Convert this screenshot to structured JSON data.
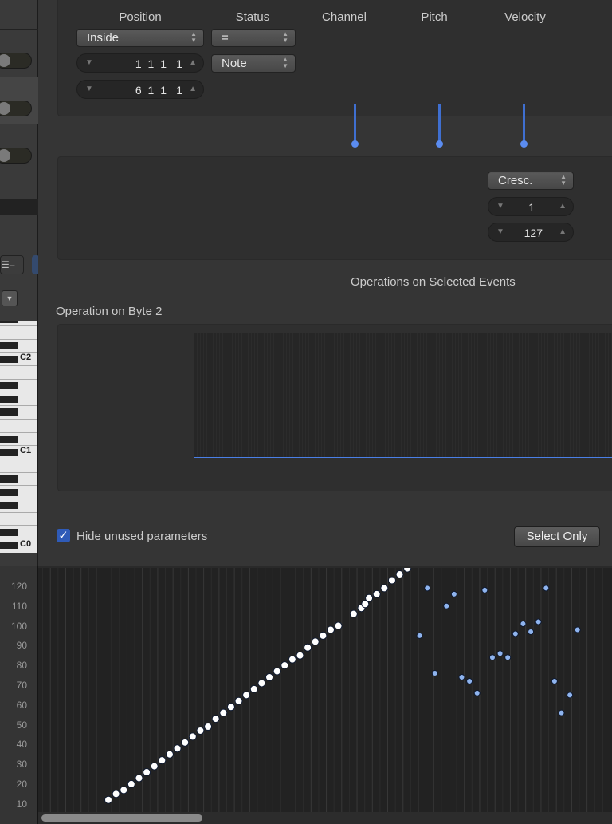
{
  "transform": {
    "columns": {
      "position": "Position",
      "status": "Status",
      "channel": "Channel",
      "pitch": "Pitch",
      "velocity": "Velocity"
    },
    "position_condition": "Inside",
    "position_from": "1 1 1",
    "position_from_tick": "1",
    "position_to": "6 1 1",
    "position_to_tick": "1",
    "status_condition": "=",
    "status_value": "Note",
    "velocity_operation": "Cresc.",
    "velocity_value1": "1",
    "velocity_value2": "127",
    "operations_title": "Operations on Selected Events",
    "byte2_title": "Operation on Byte 2",
    "hide_unused_label": "Hide unused parameters",
    "hide_unused_checked": true,
    "select_only_label": "Select Only",
    "accent_color": "#4a7fe6"
  },
  "piano": {
    "labels": [
      "C2",
      "C1",
      "C0"
    ]
  },
  "velocity_lane": {
    "y_ticks": [
      "120",
      "110",
      "100",
      "90",
      "80",
      "70",
      "60",
      "50",
      "40",
      "30",
      "20",
      "10"
    ],
    "selected_color": "#ffffff",
    "unselected_color": "#8fb4ee",
    "selected_events": [
      {
        "step": 0,
        "velocity": 8
      },
      {
        "step": 1,
        "velocity": 11
      },
      {
        "step": 2,
        "velocity": 13
      },
      {
        "step": 3,
        "velocity": 16
      },
      {
        "step": 4,
        "velocity": 19
      },
      {
        "step": 5,
        "velocity": 22
      },
      {
        "step": 6,
        "velocity": 25
      },
      {
        "step": 7,
        "velocity": 28
      },
      {
        "step": 8,
        "velocity": 31
      },
      {
        "step": 9,
        "velocity": 34
      },
      {
        "step": 10,
        "velocity": 37
      },
      {
        "step": 11,
        "velocity": 40
      },
      {
        "step": 12,
        "velocity": 43
      },
      {
        "step": 13,
        "velocity": 45
      },
      {
        "step": 14,
        "velocity": 49
      },
      {
        "step": 15,
        "velocity": 52
      },
      {
        "step": 16,
        "velocity": 55
      },
      {
        "step": 17,
        "velocity": 58
      },
      {
        "step": 18,
        "velocity": 61
      },
      {
        "step": 19,
        "velocity": 64
      },
      {
        "step": 20,
        "velocity": 67
      },
      {
        "step": 21,
        "velocity": 70
      },
      {
        "step": 22,
        "velocity": 73
      },
      {
        "step": 23,
        "velocity": 76
      },
      {
        "step": 24,
        "velocity": 79
      },
      {
        "step": 25,
        "velocity": 81
      },
      {
        "step": 26,
        "velocity": 85
      },
      {
        "step": 27,
        "velocity": 88
      },
      {
        "step": 28,
        "velocity": 91
      },
      {
        "step": 29,
        "velocity": 94
      },
      {
        "step": 30,
        "velocity": 96
      },
      {
        "step": 32,
        "velocity": 102
      },
      {
        "step": 33,
        "velocity": 105
      },
      {
        "step": 33.5,
        "velocity": 107
      },
      {
        "step": 34,
        "velocity": 110
      },
      {
        "step": 35,
        "velocity": 112
      },
      {
        "step": 36,
        "velocity": 115
      },
      {
        "step": 37,
        "velocity": 119
      },
      {
        "step": 38,
        "velocity": 122
      },
      {
        "step": 39,
        "velocity": 125
      }
    ],
    "other_events": [
      {
        "step": 40.6,
        "velocity": 91
      },
      {
        "step": 41.6,
        "velocity": 115
      },
      {
        "step": 42.6,
        "velocity": 72
      },
      {
        "step": 44.1,
        "velocity": 106
      },
      {
        "step": 45.1,
        "velocity": 112
      },
      {
        "step": 46.1,
        "velocity": 70
      },
      {
        "step": 47.1,
        "velocity": 68
      },
      {
        "step": 48.1,
        "velocity": 62
      },
      {
        "step": 49.1,
        "velocity": 114
      },
      {
        "step": 50.1,
        "velocity": 80
      },
      {
        "step": 51.1,
        "velocity": 82
      },
      {
        "step": 52.1,
        "velocity": 80
      },
      {
        "step": 53.1,
        "velocity": 92
      },
      {
        "step": 54.1,
        "velocity": 97
      },
      {
        "step": 55.1,
        "velocity": 93
      },
      {
        "step": 56.1,
        "velocity": 98
      },
      {
        "step": 57.1,
        "velocity": 115
      },
      {
        "step": 58.2,
        "velocity": 68
      },
      {
        "step": 59.1,
        "velocity": 52
      },
      {
        "step": 60.2,
        "velocity": 61
      },
      {
        "step": 61.2,
        "velocity": 94
      }
    ]
  }
}
